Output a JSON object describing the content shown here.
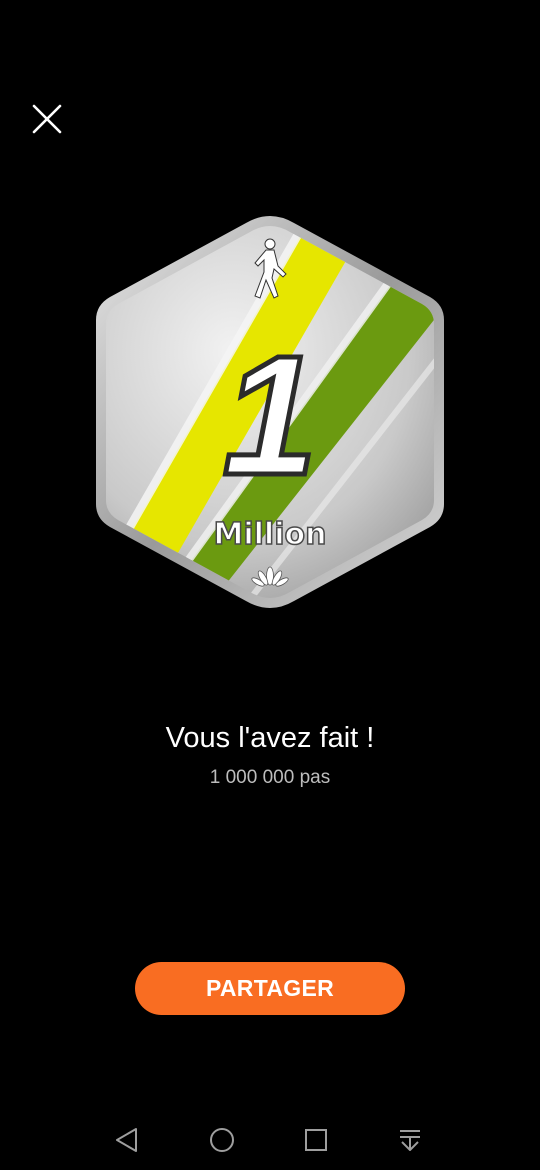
{
  "dialog": {
    "close_icon": "close-icon",
    "badge_icon": "million-steps-badge",
    "badge_number": "1",
    "badge_label": "Million",
    "title": "Vous l'avez fait !",
    "subtitle": "1 000 000 pas",
    "share_label": "PARTAGER",
    "accent_color": "#f96d22",
    "badge_colors": {
      "yellow_stripe": "#e6e600",
      "green_stripe": "#6b9a10",
      "silver": "#c8c8c8"
    }
  },
  "navbar": {
    "back_icon": "back-triangle-icon",
    "home_icon": "home-circle-icon",
    "recents_icon": "recents-square-icon",
    "notifications_icon": "pull-down-notifications-icon"
  }
}
